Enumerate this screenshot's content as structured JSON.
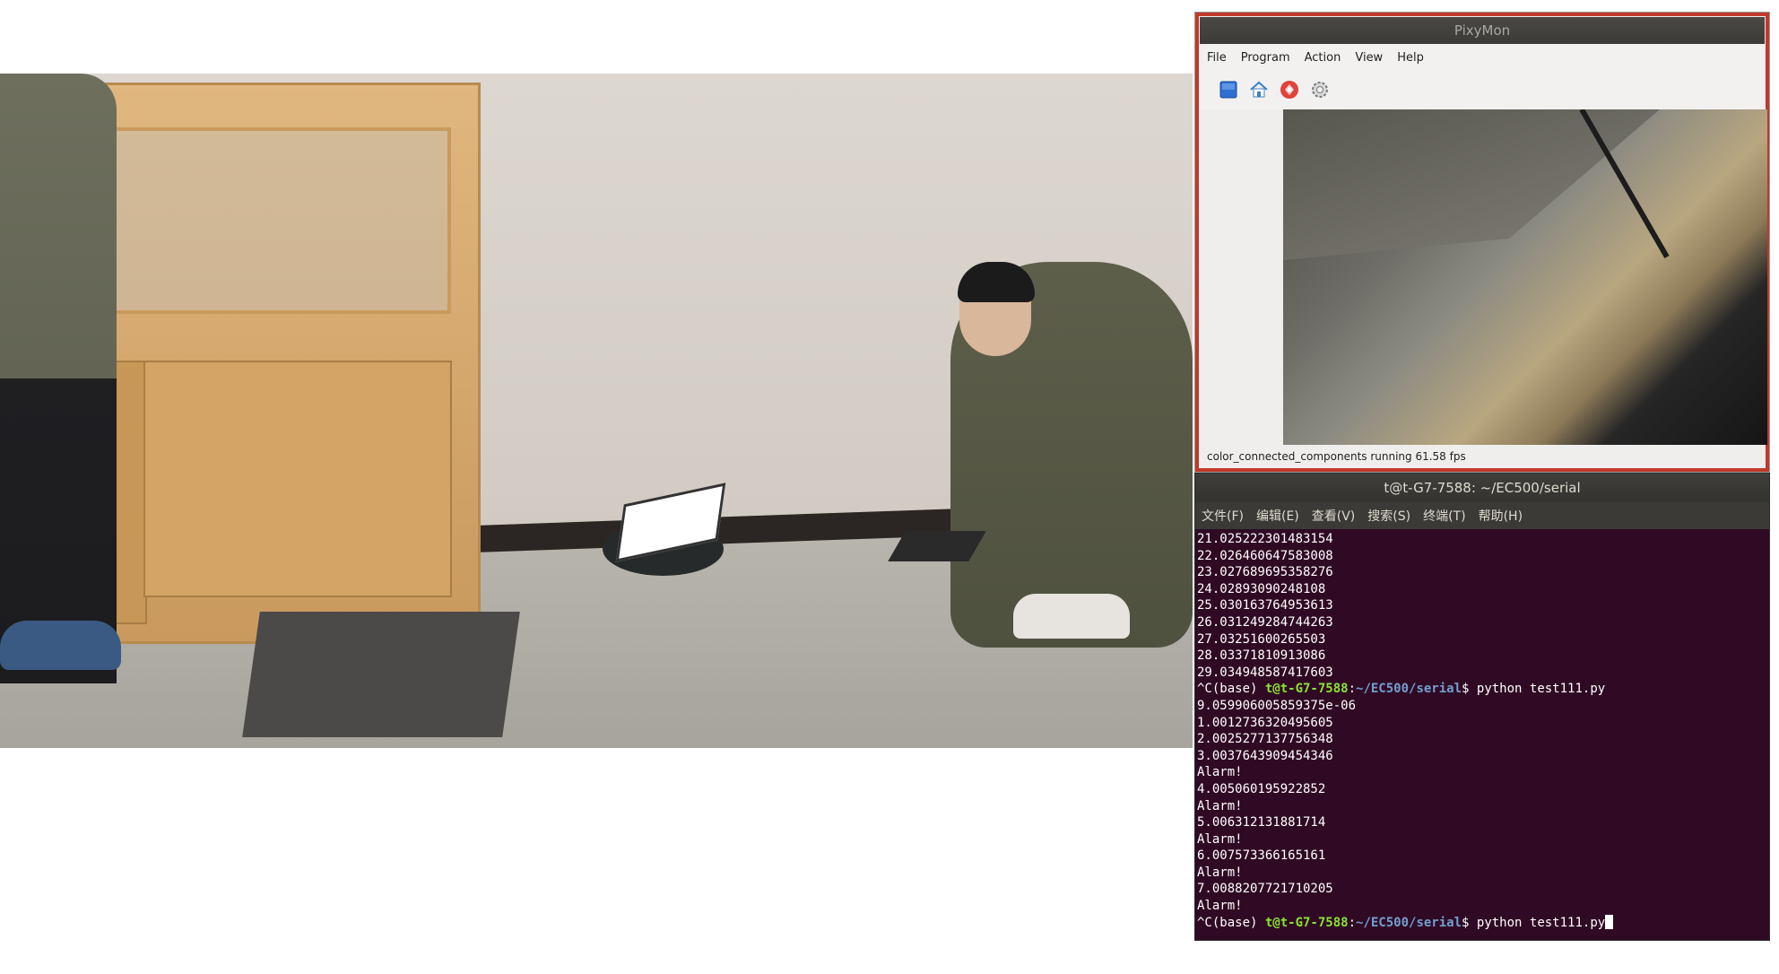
{
  "pixymon": {
    "title": "PixyMon",
    "menu": [
      "File",
      "Program",
      "Action",
      "View",
      "Help"
    ],
    "toolbar_icons": [
      "stop-icon",
      "home-icon",
      "pixy-icon",
      "settings-icon"
    ],
    "status": "color_connected_components running 61.58 fps"
  },
  "terminal": {
    "title": "t@t-G7-7588: ~/EC500/serial",
    "menu": [
      "文件(F)",
      "编辑(E)",
      "查看(V)",
      "搜索(S)",
      "终端(T)",
      "帮助(H)"
    ],
    "lines_before": [
      "21.025222301483154",
      "22.026460647583008",
      "23.027689695358276",
      "24.02893090248108",
      "25.030163764953613",
      "26.031249284744263",
      "27.03251600265503",
      "28.03371810913086",
      "29.034948587417603"
    ],
    "prompt1": {
      "prefix": "^C(base) ",
      "user": "t@t-G7-7588",
      "sep": ":",
      "path": "~/EC500/serial",
      "cmd": "$ python test111.py"
    },
    "lines_after": [
      "9.059906005859375e-06",
      "1.0012736320495605",
      "2.0025277137756348",
      "3.0037643909454346",
      "Alarm!",
      "4.005060195922852",
      "Alarm!",
      "5.006312131881714",
      "Alarm!",
      "6.007573366165161",
      "Alarm!",
      "7.0088207721710205",
      "Alarm!"
    ],
    "prompt2": {
      "prefix": "^C(base) ",
      "user": "t@t-G7-7588",
      "sep": ":",
      "path": "~/EC500/serial",
      "cmd": "$ python test111.py"
    }
  },
  "colors": {
    "terminal_bg": "#300a24",
    "prompt_user": "#8ae234",
    "prompt_path": "#729fcf",
    "pixymon_border": "#c0392b"
  }
}
